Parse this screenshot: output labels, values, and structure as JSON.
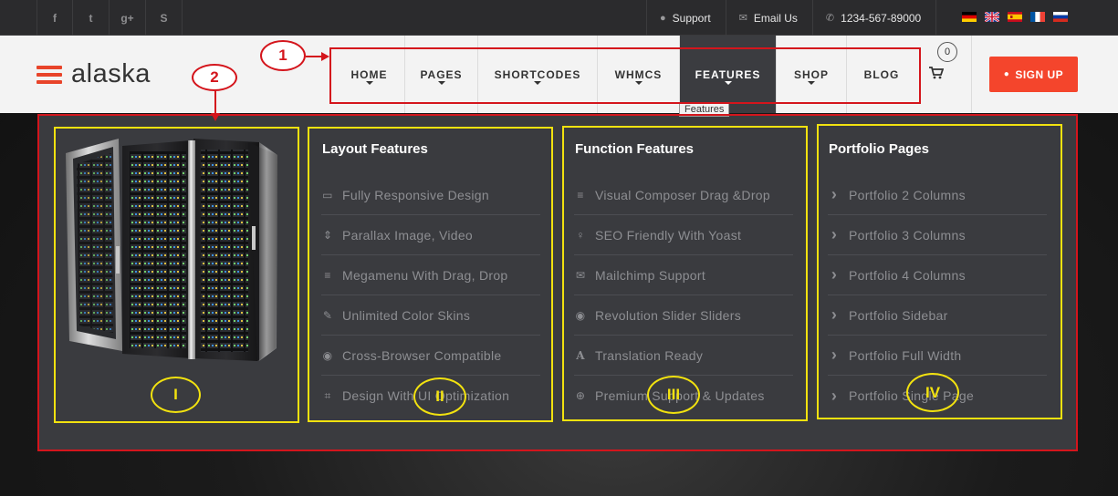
{
  "topbar": {
    "social": [
      {
        "icon": "facebook-icon",
        "glyph": "f"
      },
      {
        "icon": "twitter-icon",
        "glyph": "t"
      },
      {
        "icon": "google-plus-icon",
        "glyph": "g+"
      },
      {
        "icon": "skype-icon",
        "glyph": "S"
      }
    ],
    "support_label": "Support",
    "email_label": "Email Us",
    "phone_label": "1234-567-89000",
    "flags": [
      "german-flag-icon",
      "uk-flag-icon",
      "spanish-flag-icon",
      "french-flag-icon",
      "russian-flag-icon"
    ]
  },
  "header": {
    "logo_text": "alaska",
    "nav": [
      "HOME",
      "PAGES",
      "SHORTCODES",
      "WHMCS",
      "FEATURES",
      "SHOP",
      "BLOG"
    ],
    "active_nav": "FEATURES",
    "cart_count": "0",
    "signup_label": "SIGN UP",
    "tooltip": "Features"
  },
  "mega_menu": {
    "columns": [
      {
        "title": "Layout Features",
        "items": [
          {
            "label": "Fully Responsive Design",
            "icon": "monitor-icon",
            "glyph": "▭"
          },
          {
            "label": "Parallax Image, Video",
            "icon": "sort-icon",
            "glyph": "⇕"
          },
          {
            "label": "Megamenu With Drag, Drop",
            "icon": "align-justify-icon",
            "glyph": "≡"
          },
          {
            "label": "Unlimited Color Skins",
            "icon": "eyedropper-icon",
            "glyph": "✎"
          },
          {
            "label": "Cross-Browser Compatible",
            "icon": "globe-icon",
            "glyph": "◉"
          },
          {
            "label": "Design With UI Optimization",
            "icon": "crop-icon",
            "glyph": "⌗"
          }
        ]
      },
      {
        "title": "Function Features",
        "items": [
          {
            "label": "Visual Composer Drag &Drop",
            "icon": "align-left-icon",
            "glyph": "≡"
          },
          {
            "label": "SEO Friendly With Yoast",
            "icon": "lightbulb-icon",
            "glyph": "♀"
          },
          {
            "label": "Mailchimp Support",
            "icon": "envelope-icon",
            "glyph": "✉"
          },
          {
            "label": "Revolution Slider Sliders",
            "icon": "eye-icon",
            "glyph": "◉"
          },
          {
            "label": "Translation Ready",
            "icon": "font-icon",
            "glyph": "A"
          },
          {
            "label": "Premium Support & Updates",
            "icon": "life-ring-icon",
            "glyph": "⊕"
          }
        ]
      },
      {
        "title": "Portfolio Pages",
        "items": [
          {
            "label": "Portfolio 2 Columns",
            "icon": "chevron-right-icon",
            "glyph": "›"
          },
          {
            "label": "Portfolio 3 Columns",
            "icon": "chevron-right-icon",
            "glyph": "›"
          },
          {
            "label": "Portfolio 4 Columns",
            "icon": "chevron-right-icon",
            "glyph": "›"
          },
          {
            "label": "Portfolio Sidebar",
            "icon": "chevron-right-icon",
            "glyph": "›"
          },
          {
            "label": "Portfolio Full Width",
            "icon": "chevron-right-icon",
            "glyph": "›"
          },
          {
            "label": "Portfolio Single Page",
            "icon": "chevron-right-icon",
            "glyph": "›"
          }
        ]
      }
    ]
  },
  "annotations": {
    "callout_1": "1",
    "callout_2": "2",
    "sections": [
      "I",
      "II",
      "III",
      "IV"
    ]
  },
  "colors": {
    "accent": "#f4452c",
    "annotation_red": "#d4151c",
    "annotation_yellow": "#f2e20f",
    "mega_bg": "#3a3b3f",
    "topbar_bg": "#2b2b2d"
  }
}
